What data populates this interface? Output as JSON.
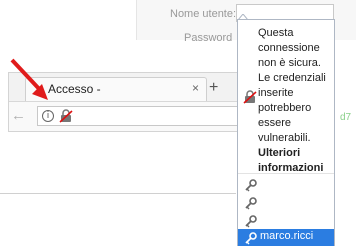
{
  "login_form": {
    "username_label": "Nome utente:",
    "password_label": "Password"
  },
  "background_link": "d7",
  "browser": {
    "tab_title": "Accesso -",
    "tab_close": "×",
    "new_tab": "+",
    "back": "←",
    "info_icon": "i"
  },
  "popup": {
    "warning_text": "Questa connessione non è sicura. Le credenziali inserite potrebbero essere vulnerabili.",
    "learn_more": "Ulteriori informazioni",
    "logins": [
      {
        "label": ""
      },
      {
        "label": ""
      },
      {
        "label": ""
      },
      {
        "label": "marco.ricci"
      }
    ]
  },
  "colors": {
    "selection": "#2b7de1",
    "arrow": "#e01b1b",
    "lock_strike": "#d11"
  }
}
